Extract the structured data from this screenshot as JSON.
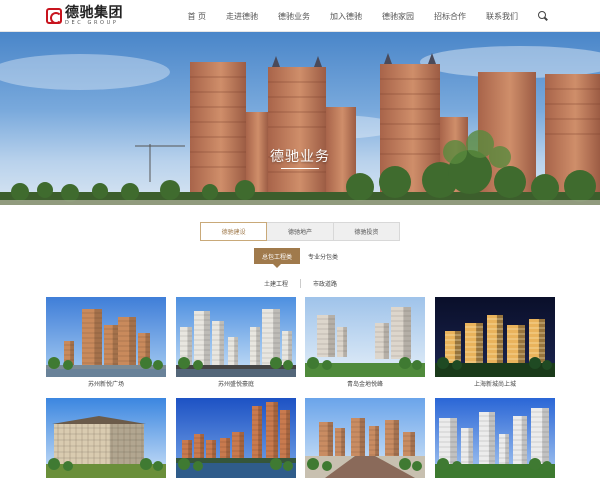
{
  "brand": {
    "name_cn": "德驰集团",
    "name_en": "DEC GROUP",
    "logo_color": "#c8141e"
  },
  "nav": {
    "items": [
      "首 页",
      "走进德驰",
      "德驰业务",
      "加入德驰",
      "德驰家园",
      "招标合作",
      "联系我们"
    ],
    "search_icon": "search-icon"
  },
  "banner": {
    "title": "德驰业务"
  },
  "tabs": {
    "items": [
      "德驰建设",
      "德驰地产",
      "德驰投资"
    ],
    "active_index": 0,
    "active_color": "#a07a4c"
  },
  "subtabs": {
    "items": [
      "总包工程类",
      "专业分包类"
    ],
    "active_index": 0
  },
  "categories": {
    "items": [
      "土建工程",
      "市政道路"
    ]
  },
  "projects": [
    {
      "caption": "苏州新悦广场",
      "sky": "#3f7ed8",
      "sky2": "#a8cdf2",
      "bld": "#c98a5c",
      "ground": "#7a8a95",
      "scene": "towers-warm"
    },
    {
      "caption": "苏州盛悦豪庭",
      "sky": "#4d8fe0",
      "sky2": "#c9e1f7",
      "bld": "#e8e6e0",
      "ground": "#444",
      "scene": "towers-white"
    },
    {
      "caption": "青岛金地悦峰",
      "sky": "#9fc3ea",
      "sky2": "#e3eef8",
      "bld": "#ddd6cc",
      "ground": "#4f8a3b",
      "scene": "towers-garden"
    },
    {
      "caption": "上海新城尚上城",
      "sky": "#0a0f2a",
      "sky2": "#1b2550",
      "bld": "#e9b35c",
      "ground": "#1a3a1a",
      "scene": "night"
    },
    {
      "caption": "",
      "sky": "#3b86e0",
      "sky2": "#cfe3f8",
      "bld": "#d9cbb0",
      "ground": "#6a8f3a",
      "scene": "villa"
    },
    {
      "caption": "",
      "sky": "#1d52c4",
      "sky2": "#7aa8e8",
      "bld": "#c97a4e",
      "ground": "#35563a",
      "scene": "towers-lake"
    },
    {
      "caption": "",
      "sky": "#6aa4ea",
      "sky2": "#d6e7f8",
      "bld": "#c98c62",
      "ground": "#8a6a5a",
      "scene": "towers-road"
    },
    {
      "caption": "",
      "sky": "#2a66d6",
      "sky2": "#a9c9f1",
      "bld": "#ececec",
      "ground": "#3d7a2f",
      "scene": "towers-green"
    }
  ]
}
